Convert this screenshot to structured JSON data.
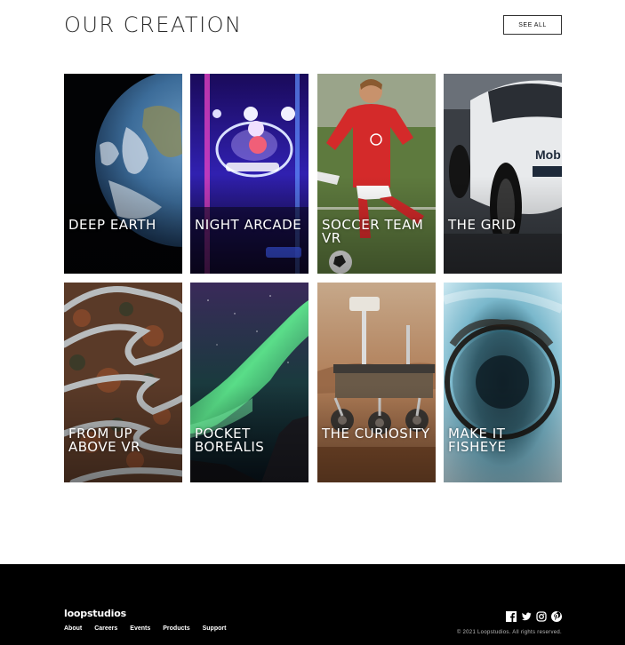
{
  "header": {
    "title": "OUR CREATION",
    "see_all_label": "SEE ALL"
  },
  "creations": [
    {
      "label": "DEEP EARTH"
    },
    {
      "label": "NIGHT ARCADE"
    },
    {
      "label": "SOCCER TEAM VR"
    },
    {
      "label": "THE GRID"
    },
    {
      "label": "FROM UP ABOVE VR"
    },
    {
      "label": "POCKET BOREALIS"
    },
    {
      "label": "THE CURIOSITY"
    },
    {
      "label": "MAKE IT FISHEYE"
    }
  ],
  "footer": {
    "logo": "loopstudios",
    "nav": [
      "About",
      "Careers",
      "Events",
      "Products",
      "Support"
    ],
    "social_icons": [
      "facebook-icon",
      "twitter-icon",
      "instagram-icon",
      "pinterest-icon"
    ],
    "copyright": "© 2021 Loopstudios. All rights reserved."
  }
}
